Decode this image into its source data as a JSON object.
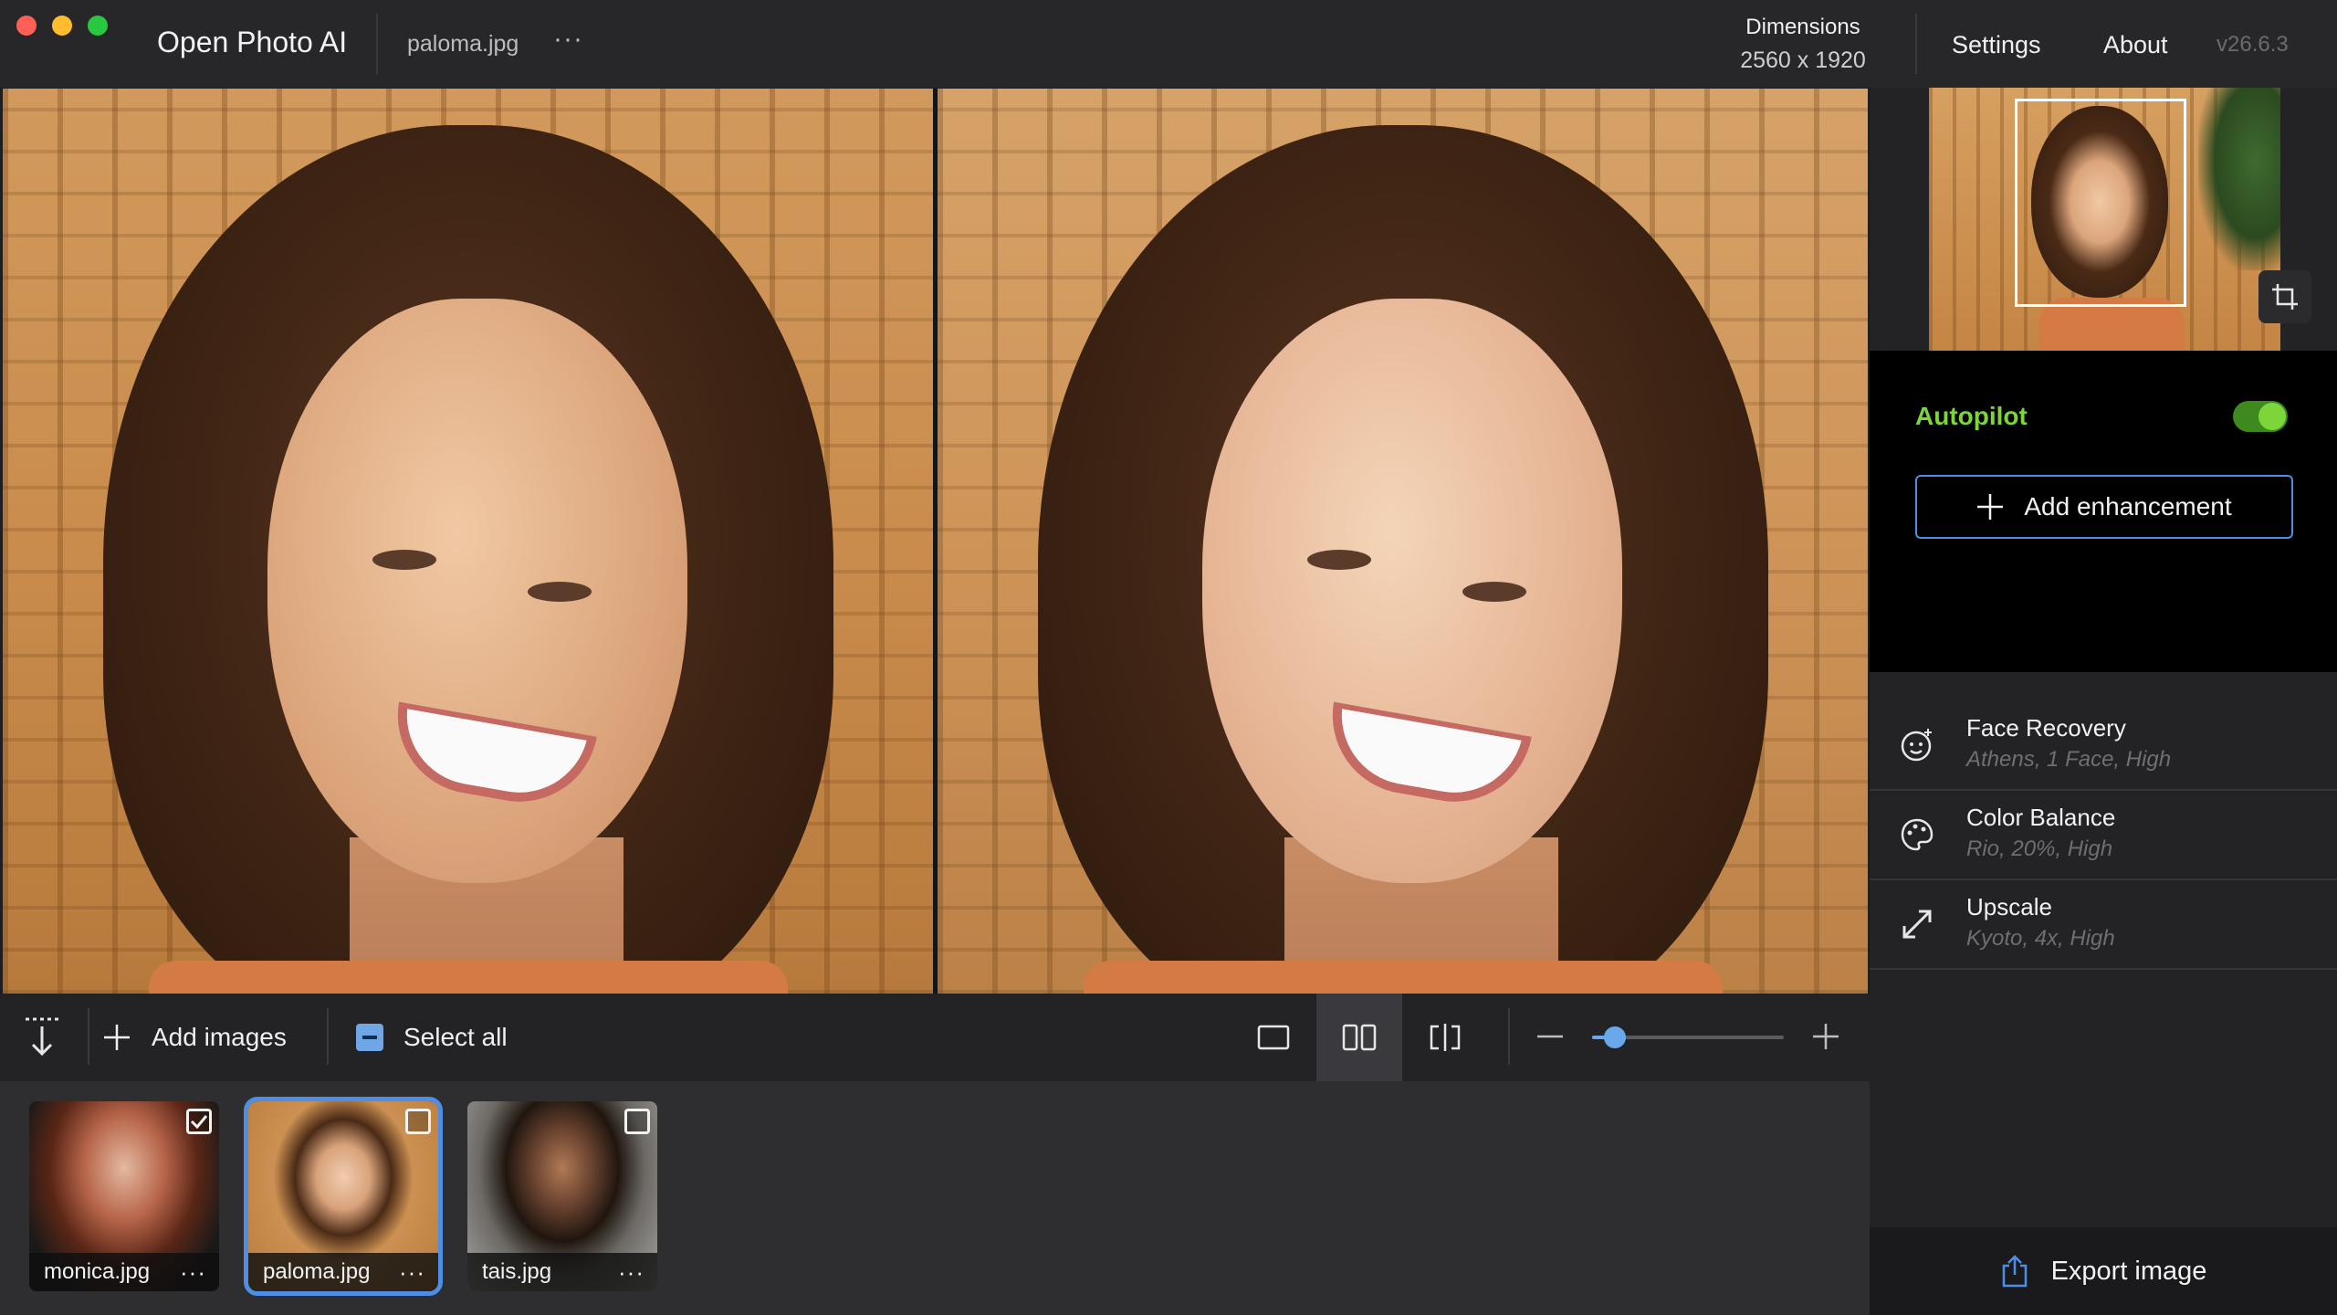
{
  "app": {
    "title": "Open Photo AI",
    "version": "v26.6.3"
  },
  "file": {
    "name": "paloma.jpg",
    "menu": "···"
  },
  "dimensions": {
    "label": "Dimensions",
    "value": "2560 x 1920"
  },
  "nav": {
    "settings": "Settings",
    "about": "About"
  },
  "toolbar": {
    "add_images": "Add images",
    "select_all": "Select all",
    "zoom_level": 0.12
  },
  "thumbnails": [
    {
      "name": "monica.jpg",
      "more": "···",
      "checked": true
    },
    {
      "name": "paloma.jpg",
      "more": "···",
      "checked": false,
      "selected": true
    },
    {
      "name": "tais.jpg",
      "more": "···",
      "checked": false
    }
  ],
  "panel": {
    "autopilot_label": "Autopilot",
    "autopilot_on": true,
    "add_enhancement": "Add enhancement",
    "enhancements": [
      {
        "title": "Face Recovery",
        "subtitle": "Athens, 1 Face, High",
        "icon": "face-icon"
      },
      {
        "title": "Color Balance",
        "subtitle": "Rio, 20%, High",
        "icon": "palette-icon"
      },
      {
        "title": "Upscale",
        "subtitle": "Kyoto, 4x, High",
        "icon": "expand-icon"
      }
    ],
    "export": "Export image"
  },
  "colors": {
    "accent": "#4d8fe6",
    "autopilot": "#7cd63a"
  }
}
